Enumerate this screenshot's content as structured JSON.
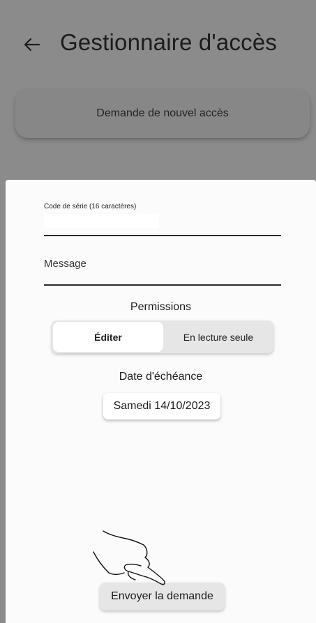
{
  "header": {
    "back_icon": "arrow-left-icon",
    "title": "Gestionnaire d'accès"
  },
  "main": {
    "new_access_label": "Demande de nouvel accès"
  },
  "sheet": {
    "serial": {
      "label": "Code de série (16 caractères)",
      "value": ""
    },
    "message": {
      "placeholder": "Message",
      "value": ""
    },
    "permissions": {
      "title": "Permissions",
      "options": [
        "Éditer",
        "En lecture seule"
      ],
      "selected": "Éditer"
    },
    "due_date": {
      "title": "Date d'échéance",
      "value": "Samedi 14/10/2023"
    },
    "send_label": "Envoyer la demande"
  },
  "overlay": {
    "gesture_icon": "tap-hand-icon"
  },
  "colors": {
    "scrim": "#8b8b8b",
    "sheet": "#fbfbfb",
    "segment_bg": "#e6e6e6",
    "segment_active": "#ffffff"
  }
}
